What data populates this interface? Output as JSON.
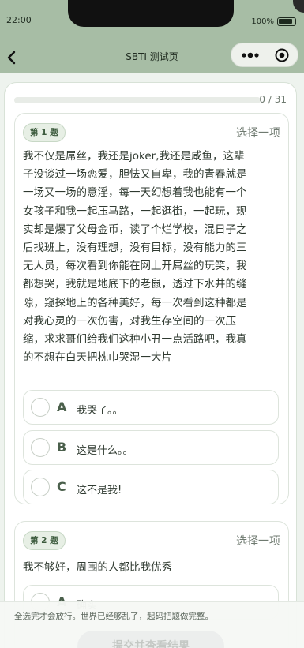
{
  "status": {
    "time": "22:00",
    "battery": "100%"
  },
  "nav": {
    "title": "SBTI 测试页"
  },
  "progress": {
    "text": "0 / 31",
    "fraction": 0.0
  },
  "questions": [
    {
      "badge": "第 1 题",
      "hint": "选择一项",
      "lines": [
        "我不仅是屌丝，我还是joker,我还是咸鱼，这辈",
        "子没谈过一场恋爱，胆怯又自卑，我的青春就是",
        "一场又一场的意淫，每一天幻想着我也能有一个",
        "女孩子和我一起压马路，一起逛街，一起玩，现",
        "实却是爆了父母金币，读了个烂学校，混日子之",
        "后找班上，没有理想，没有目标，没有能力的三",
        "无人员，每次看到你能在网上开屌丝的玩笑，我",
        "都想哭，我就是地底下的老鼠，透过下水井的缝",
        "隙，窥探地上的各种美好，每一次看到这种都是",
        "对我心灵的一次伤害，对我生存空间的一次压",
        "缩，求求哥们给我们这种小丑一点活路吧，我真",
        "的不想在白天把枕巾哭湿一大片"
      ],
      "options": [
        {
          "letter": "A",
          "text": "我哭了。。"
        },
        {
          "letter": "B",
          "text": "这是什么。。"
        },
        {
          "letter": "C",
          "text": "这不是我!"
        }
      ]
    },
    {
      "badge": "第 2 题",
      "hint": "选择一项",
      "lines": [
        "我不够好，周围的人都比我优秀"
      ],
      "options": [
        {
          "letter": "A",
          "text": "确实"
        }
      ]
    }
  ],
  "footer": {
    "hint": "全选完才会放行。世界已经够乱了，起码把题做完整。",
    "submit_label": "提交并查看结果"
  },
  "colors": {
    "accent": "#a7bda5",
    "progress": "#7f9a7c"
  }
}
